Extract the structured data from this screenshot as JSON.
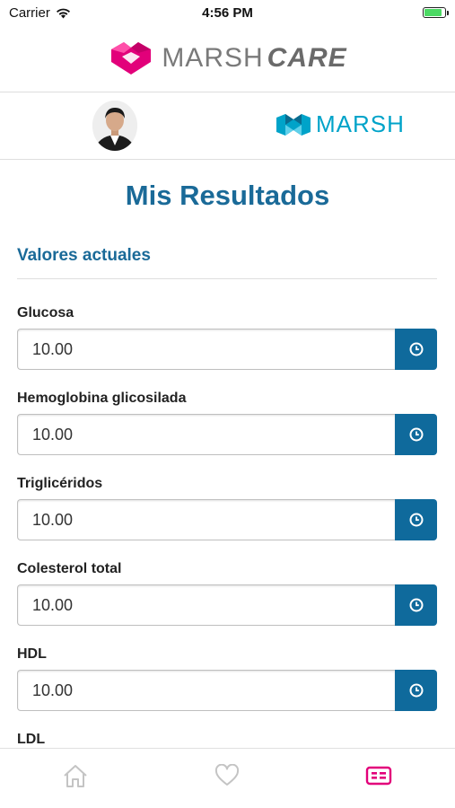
{
  "status_bar": {
    "carrier": "Carrier",
    "time": "4:56 PM",
    "battery_level": 0.85
  },
  "brand": {
    "name": "MARSH",
    "suffix": "CARE",
    "logo_color": "#e2007a"
  },
  "company_logo": {
    "name": "MARSH",
    "color": "#00a3c9"
  },
  "page": {
    "title": "Mis Resultados"
  },
  "section": {
    "title": "Valores actuales"
  },
  "fields": [
    {
      "label": "Glucosa",
      "value": "10.00"
    },
    {
      "label": "Hemoglobina glicosilada",
      "value": "10.00"
    },
    {
      "label": "Triglicéridos",
      "value": "10.00"
    },
    {
      "label": "Colesterol total",
      "value": "10.00"
    },
    {
      "label": "HDL",
      "value": "10.00"
    },
    {
      "label": "LDL"
    }
  ],
  "tab_bar": {
    "items": [
      "home-icon",
      "heart-icon",
      "id-card-icon"
    ],
    "active_color": "#e2007a",
    "inactive_color": "#c4c4c4"
  },
  "colors": {
    "primary": "#0f6a9c",
    "title": "#1a6a98"
  }
}
